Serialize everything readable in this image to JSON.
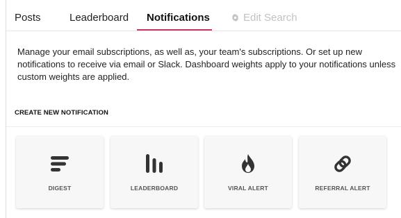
{
  "tabs": [
    {
      "label": "Posts"
    },
    {
      "label": "Leaderboard"
    },
    {
      "label": "Notifications"
    },
    {
      "label": "Edit Search",
      "icon": "gear-icon"
    }
  ],
  "active_tab": "Notifications",
  "description": "Manage your email subscriptions, as well as, your team's subscriptions. Or set up new notifications to receive via email or Slack. Dashboard weights apply to your notifications unless custom weights are applied.",
  "section_title": "CREATE NEW NOTIFICATION",
  "cards": [
    {
      "label": "DIGEST",
      "icon": "digest-lines-icon"
    },
    {
      "label": "LEADERBOARD",
      "icon": "leaderboard-bars-icon"
    },
    {
      "label": "VIRAL ALERT",
      "icon": "flame-icon"
    },
    {
      "label": "REFERRAL ALERT",
      "icon": "link-icon"
    }
  ],
  "colors": {
    "accent": "#c8366b",
    "icon": "#333333",
    "disabled_text": "#c2c2c2"
  }
}
